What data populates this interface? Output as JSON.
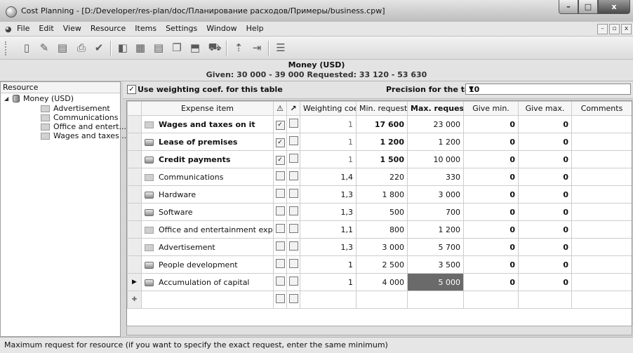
{
  "window": {
    "title": "Cost Planning - [D:/Developer/res-plan/doc/Планирование расходов/Примеры/business.cpw]",
    "controls": [
      "–",
      "□",
      "x"
    ]
  },
  "menu": {
    "items": [
      "File",
      "Edit",
      "View",
      "Resource",
      "Items",
      "Settings",
      "Window",
      "Help"
    ],
    "mdi_controls": [
      "–",
      "▫",
      "x"
    ]
  },
  "toolbar": {
    "icons": [
      "new-icon",
      "open-icon",
      "save-icon",
      "print-icon",
      "check-icon",
      "resource-icon",
      "table-add-icon",
      "table-edit-icon",
      "copy-icon",
      "export-icon",
      "cart-icon",
      "import-icon",
      "import2-icon",
      "list-icon"
    ]
  },
  "header": {
    "resource": "Money (USD)",
    "summary": "Given: 30 000 - 39 000   Requested: 33 120 - 53 630"
  },
  "resource_pane": {
    "title": "Resource",
    "root": "Money (USD)",
    "children": [
      "Advertisement",
      "Communications",
      "Office and entert...",
      "Wages and taxes ..."
    ]
  },
  "options": {
    "use_weighting_label": "Use weighting coef. for this table",
    "use_weighting_checked": "✓",
    "precision_label": "Precision for the table",
    "precision_value": "10"
  },
  "table": {
    "columns": {
      "item": "Expense item",
      "warn": "⚠",
      "ext": "↗",
      "weight": "Weighting coef",
      "min": "Min. request",
      "max": "Max. request",
      "give_min": "Give min.",
      "give_max": "Give max.",
      "comments": "Comments"
    },
    "rows": [
      {
        "name": "Wages and taxes on it",
        "icon": "folder",
        "bold": true,
        "warn": "✓",
        "ext": "",
        "weight": "1",
        "min": "17 600",
        "max": "23 000",
        "give_min": "0",
        "give_max": "0",
        "comments": ""
      },
      {
        "name": "Lease of premises",
        "icon": "device",
        "bold": true,
        "warn": "✓",
        "ext": "",
        "weight": "1",
        "min": "1 200",
        "max": "1 200",
        "give_min": "0",
        "give_max": "0",
        "comments": ""
      },
      {
        "name": "Credit payments",
        "icon": "device",
        "bold": true,
        "warn": "✓",
        "ext": "",
        "weight": "1",
        "min": "1 500",
        "max": "10 000",
        "give_min": "0",
        "give_max": "0",
        "comments": ""
      },
      {
        "name": "Communications",
        "icon": "folder",
        "bold": false,
        "warn": "",
        "ext": "",
        "weight": "1,4",
        "min": "220",
        "max": "330",
        "give_min": "0",
        "give_max": "0",
        "comments": ""
      },
      {
        "name": "Hardware",
        "icon": "device",
        "bold": false,
        "warn": "",
        "ext": "",
        "weight": "1,3",
        "min": "1 800",
        "max": "3 000",
        "give_min": "0",
        "give_max": "0",
        "comments": ""
      },
      {
        "name": "Software",
        "icon": "device",
        "bold": false,
        "warn": "",
        "ext": "",
        "weight": "1,3",
        "min": "500",
        "max": "700",
        "give_min": "0",
        "give_max": "0",
        "comments": ""
      },
      {
        "name": "Office and entertainment expenses",
        "icon": "folder",
        "bold": false,
        "warn": "",
        "ext": "",
        "weight": "1,1",
        "min": "800",
        "max": "1 200",
        "give_min": "0",
        "give_max": "0",
        "comments": ""
      },
      {
        "name": "Advertisement",
        "icon": "folder",
        "bold": false,
        "warn": "",
        "ext": "",
        "weight": "1,3",
        "min": "3 000",
        "max": "5 700",
        "give_min": "0",
        "give_max": "0",
        "comments": ""
      },
      {
        "name": "People development",
        "icon": "device",
        "bold": false,
        "warn": "",
        "ext": "",
        "weight": "1",
        "min": "2 500",
        "max": "3 500",
        "give_min": "0",
        "give_max": "0",
        "comments": ""
      },
      {
        "name": "Accumulation of capital",
        "icon": "device",
        "bold": false,
        "warn": "",
        "ext": "",
        "weight": "1",
        "min": "4 000",
        "max": "5 000",
        "give_min": "0",
        "give_max": "0",
        "comments": "",
        "current": true
      }
    ],
    "current_row_marker": "▶",
    "new_row_marker": "✚"
  },
  "statusbar": {
    "text": "Maximum request for resource (if you want to specify the exact request, enter the same minimum)"
  }
}
